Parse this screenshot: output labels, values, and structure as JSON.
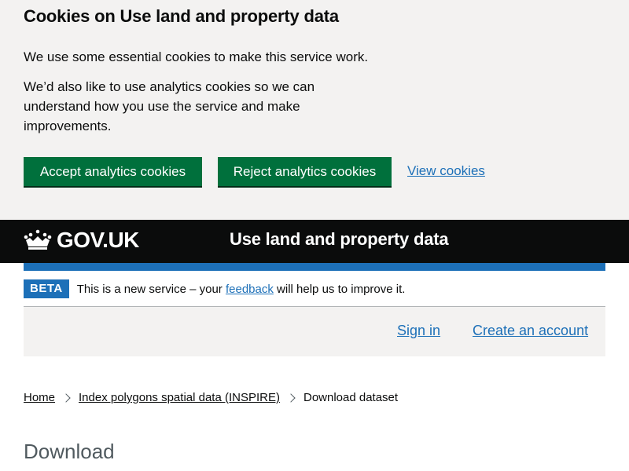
{
  "cookie_banner": {
    "title": "Cookies on Use land and property data",
    "paragraph_1": "We use some essential cookies to make this service work.",
    "paragraph_2": "We’d also like to use analytics cookies so we can understand how you use the service and make improvements.",
    "accept_label": "Accept analytics cookies",
    "reject_label": "Reject analytics cookies",
    "view_label": "View cookies"
  },
  "header": {
    "logo_text": "GOV.UK",
    "service_name": "Use land and property data"
  },
  "phase_banner": {
    "tag": "BETA",
    "text_before": "This is a new service – your ",
    "link": "feedback",
    "text_after": " will help us to improve it."
  },
  "account": {
    "sign_in": "Sign in",
    "create_account": "Create an account"
  },
  "breadcrumb": {
    "items": [
      "Home",
      "Index polygons spatial data (INSPIRE)"
    ],
    "current": "Download dataset"
  },
  "main": {
    "heading": "Download"
  },
  "colors": {
    "button_green": "#00703c",
    "link_blue": "#1d70b8",
    "header_black": "#0b0c0c",
    "banner_grey": "#f3f2f1"
  }
}
